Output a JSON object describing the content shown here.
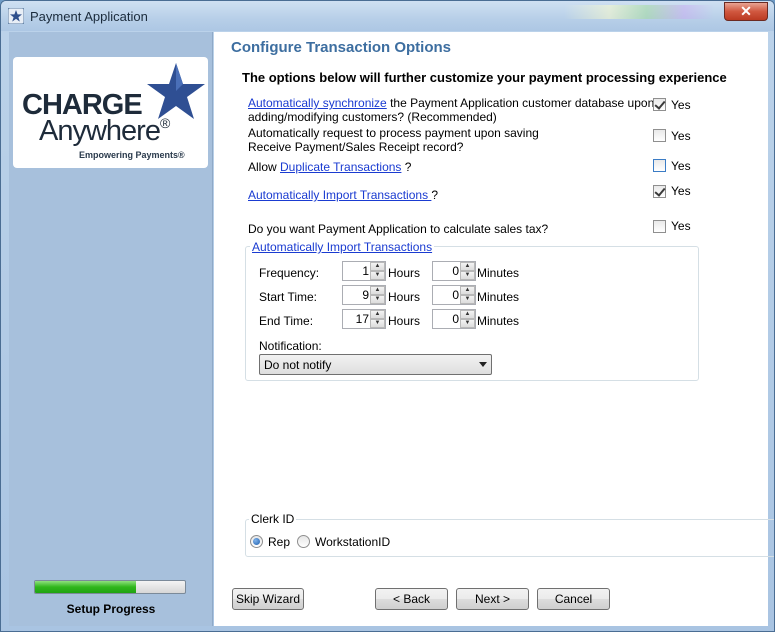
{
  "window": {
    "title": "Payment Application",
    "close_label": "✕"
  },
  "sidebar": {
    "logo": {
      "line1": "CHARGE",
      "line2": "Anywhere",
      "reg": "®",
      "tagline": "Empowering Payments®"
    },
    "progress": {
      "value": 0.67,
      "label": "Setup Progress"
    }
  },
  "main": {
    "title": "Configure Transaction Options",
    "subtitle": "The options below will further customize your payment processing experience",
    "options": {
      "sync": {
        "link": "Automatically synchronize",
        "text1": " the Payment Application customer database upon",
        "text2": "adding/modifying customers? (Recommended)",
        "checked": true,
        "yes": "Yes"
      },
      "autopay": {
        "text1": "Automatically request to process payment upon saving",
        "text2": "Receive Payment/Sales Receipt record?",
        "checked": false,
        "yes": "Yes"
      },
      "duplicate": {
        "prefix": "Allow ",
        "link": "Duplicate Transactions",
        "suffix": "  ?",
        "checked": false,
        "yes": "Yes"
      },
      "import": {
        "link": "Automatically Import Transactions ",
        "suffix": " ?",
        "checked": true,
        "yes": "Yes"
      },
      "salestax": {
        "text": "Do you want Payment Application to calculate sales tax?",
        "checked": false,
        "yes": "Yes"
      }
    },
    "import_group": {
      "legend": "Automatically Import Transactions ",
      "frequency": {
        "label": "Frequency:",
        "hours": "1",
        "hours_unit": "Hours",
        "minutes": "0",
        "minutes_unit": "Minutes"
      },
      "start": {
        "label": "Start Time:",
        "hours": "9",
        "hours_unit": "Hours",
        "minutes": "0",
        "minutes_unit": "Minutes"
      },
      "end": {
        "label": "End Time:",
        "hours": "17",
        "hours_unit": "Hours",
        "minutes": "0",
        "minutes_unit": "Minutes"
      },
      "notification_label": "Notification:",
      "notification_value": "Do not notify"
    },
    "clerk_group": {
      "legend": "Clerk ID",
      "options": [
        {
          "label": "Rep",
          "selected": true
        },
        {
          "label": "WorkstationID",
          "selected": false
        }
      ]
    },
    "buttons": {
      "skip": "Skip Wizard",
      "back": "< Back",
      "next": "Next >",
      "cancel": "Cancel"
    }
  },
  "colors": {
    "title_blue": "#3d6ea0",
    "link_blue": "#1a3bd1",
    "progress_green": "#2fb61c"
  }
}
